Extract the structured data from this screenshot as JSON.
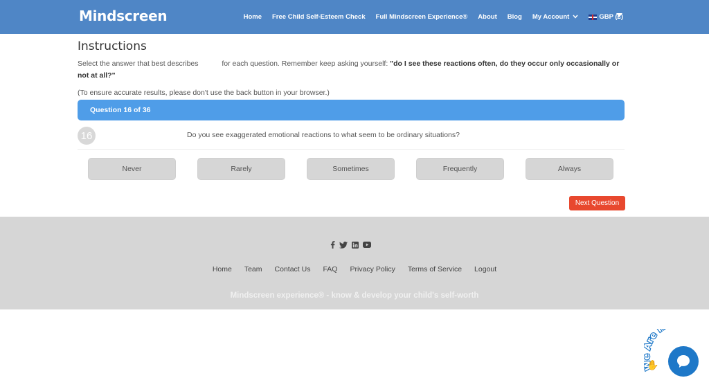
{
  "header": {
    "logo": "Mindscreen",
    "nav": [
      {
        "label": "Home"
      },
      {
        "label": "Free Child Self-Esteem Check"
      },
      {
        "label": "Full Mindscreen Experience®"
      },
      {
        "label": "About"
      },
      {
        "label": "Blog"
      },
      {
        "label": "My Account"
      },
      {
        "label": "GBP (£)"
      }
    ]
  },
  "instructions": {
    "title": "Instructions",
    "text_before": "Select the answer that best describes",
    "text_after": "for each question. Remember keep asking yourself:",
    "text_bold": "\"do I see these reactions often, do they occur only occasionally or not at all?\"",
    "note": "(To ensure accurate results, please don't use the back button in your browser.)"
  },
  "question": {
    "bar_label": "Question 16 of 36",
    "number": "16",
    "text": "Do you see exaggerated emotional reactions to what seem to be ordinary situations?",
    "answers": [
      "Never",
      "Rarely",
      "Sometimes",
      "Frequently",
      "Always"
    ],
    "next_label": "Next Question"
  },
  "footer": {
    "social_icons": [
      "facebook-icon",
      "twitter-icon",
      "linkedin-icon",
      "youtube-icon"
    ],
    "nav": [
      "Home",
      "Team",
      "Contact Us",
      "FAQ",
      "Privacy Policy",
      "Terms of Service",
      "Logout"
    ],
    "tagline": "Mindscreen experience® - know & develop your child's self-worth"
  },
  "chat": {
    "badge_text": "We Are Here!"
  },
  "colors": {
    "header_bg": "#4f86c6",
    "question_bar": "#4f9de8",
    "next_button": "#e8482e",
    "footer_bg": "#d6d6d6",
    "chat_button": "#1e78c8"
  }
}
